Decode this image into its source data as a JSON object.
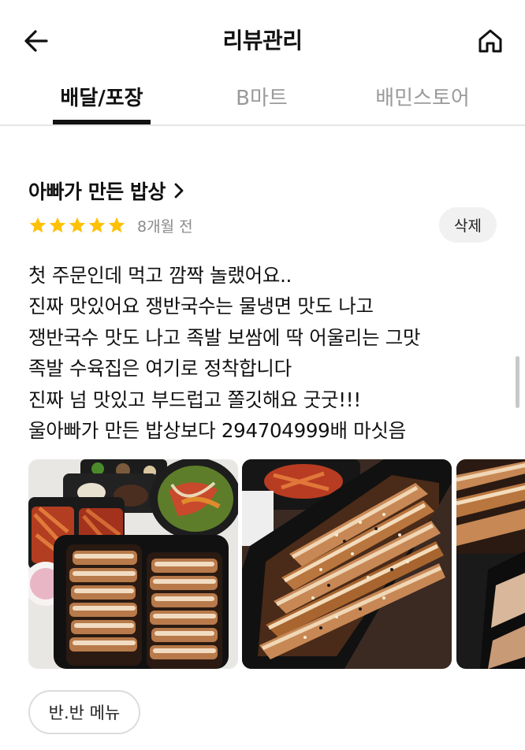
{
  "header": {
    "title": "리뷰관리",
    "back_icon": "arrow-left-icon",
    "home_icon": "home-icon"
  },
  "tabs": [
    {
      "label": "배달/포장",
      "active": true
    },
    {
      "label": "B마트",
      "active": false
    },
    {
      "label": "배민스토어",
      "active": false
    }
  ],
  "review": {
    "store_name": "아빠가 만든 밥상",
    "rating": 5,
    "max_rating": 5,
    "star_color": "#FFC107",
    "time_ago": "8개월 전",
    "delete_label": "삭제",
    "lines": [
      "첫 주문인데 먹고 깜짝 놀랬어요..",
      "진짜 맛있어요 쟁반국수는 물냉면 맛도 나고",
      "쟁반국수 맛도 나고 족발 보쌈에 딱 어울리는 그맛",
      "족발 수육집은 여기로 정착합니다",
      "진짜 넘 맛있고 부드럽고 쫄깃해요 굿굿!!!",
      "울아빠가 만든 밥상보다 294704999배 마싯음"
    ],
    "photos": [
      "food-photo-1",
      "food-photo-2",
      "food-photo-3"
    ],
    "menu_tag": "반.반 메뉴"
  }
}
